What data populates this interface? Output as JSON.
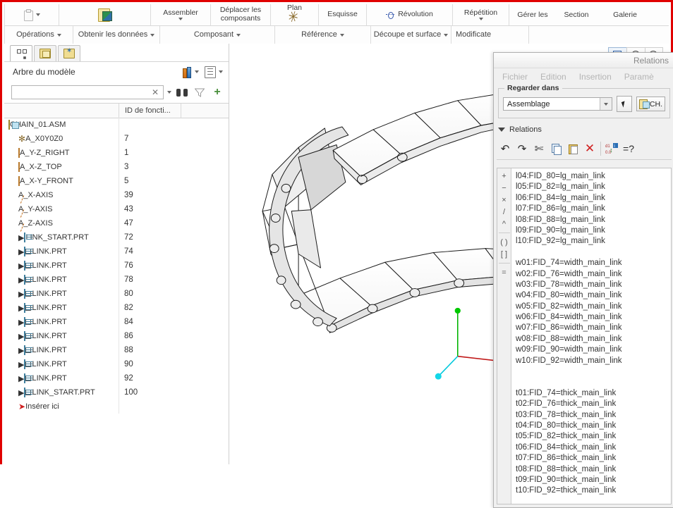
{
  "ribbon": {
    "row1": [
      {
        "label": "",
        "icon": "clipboard-icon",
        "has_caret": true
      },
      {
        "label": "",
        "icon": "get-data-icon",
        "has_caret": false
      },
      {
        "label": "Assembler",
        "icon": "",
        "has_caret": true
      },
      {
        "label": "Déplacer les composants",
        "icon": "",
        "has_caret": false
      },
      {
        "label": "Plan",
        "icon": "plane-icon",
        "has_caret": false
      },
      {
        "label": "Esquisse",
        "icon": "",
        "has_caret": false
      },
      {
        "label": "Révolution",
        "icon": "revolve-icon",
        "has_caret": false
      },
      {
        "label": "Répétition",
        "icon": "",
        "has_caret": true
      },
      {
        "label": "Gérer les",
        "icon": "",
        "has_caret": false
      },
      {
        "label": "Section",
        "icon": "",
        "has_caret": false
      },
      {
        "label": "Galerie",
        "icon": "",
        "has_caret": false
      }
    ],
    "row2": [
      {
        "label": "Opérations",
        "has_caret": true
      },
      {
        "label": "Obtenir les données",
        "has_caret": true
      },
      {
        "label": "Composant",
        "has_caret": true
      },
      {
        "label": "Référence",
        "has_caret": true
      },
      {
        "label": "Découpe et surface",
        "has_caret": true
      },
      {
        "label": "Modificate",
        "has_caret": false
      }
    ]
  },
  "navigator": {
    "tabs": [
      {
        "name": "model-tree-tab",
        "icon": "tree-icon"
      },
      {
        "name": "folder-browser-tab",
        "icon": "folders-icon"
      },
      {
        "name": "favorites-tab",
        "icon": "favorites-folder-icon"
      }
    ],
    "title": "Arbre du modèle",
    "search": {
      "value": "",
      "placeholder": ""
    },
    "columns": [
      "",
      "ID de foncti...",
      ""
    ],
    "tree": [
      {
        "indent": 0,
        "expander": false,
        "icon": "assembly-icon",
        "label": "CHAIN_01.ASM",
        "id": ""
      },
      {
        "indent": 1,
        "expander": false,
        "icon": "csys-icon",
        "label": "A_X0Y0Z0",
        "id": "7"
      },
      {
        "indent": 1,
        "expander": false,
        "icon": "plane-icon",
        "label": "A_Y-Z_RIGHT",
        "id": "1"
      },
      {
        "indent": 1,
        "expander": false,
        "icon": "plane-icon",
        "label": "A_X-Z_TOP",
        "id": "3"
      },
      {
        "indent": 1,
        "expander": false,
        "icon": "plane-icon",
        "label": "A_X-Y_FRONT",
        "id": "5"
      },
      {
        "indent": 1,
        "expander": false,
        "icon": "axis-icon",
        "label": "A_X-AXIS",
        "id": "39"
      },
      {
        "indent": 1,
        "expander": false,
        "icon": "axis-icon",
        "label": "A_Y-AXIS",
        "id": "43"
      },
      {
        "indent": 1,
        "expander": false,
        "icon": "axis-icon",
        "label": "A_Z-AXIS",
        "id": "47"
      },
      {
        "indent": 1,
        "expander": true,
        "icon": "part-icon",
        "label": "LINK_START.PRT",
        "id": "72",
        "badge": false
      },
      {
        "indent": 1,
        "expander": true,
        "icon": "part-icon",
        "label": "LINK.PRT",
        "id": "74",
        "badge": true
      },
      {
        "indent": 1,
        "expander": true,
        "icon": "part-icon",
        "label": "LINK.PRT",
        "id": "76",
        "badge": true
      },
      {
        "indent": 1,
        "expander": true,
        "icon": "part-icon",
        "label": "LINK.PRT",
        "id": "78",
        "badge": true
      },
      {
        "indent": 1,
        "expander": true,
        "icon": "part-icon",
        "label": "LINK.PRT",
        "id": "80",
        "badge": true
      },
      {
        "indent": 1,
        "expander": true,
        "icon": "part-icon",
        "label": "LINK.PRT",
        "id": "82",
        "badge": true
      },
      {
        "indent": 1,
        "expander": true,
        "icon": "part-icon",
        "label": "LINK.PRT",
        "id": "84",
        "badge": true
      },
      {
        "indent": 1,
        "expander": true,
        "icon": "part-icon",
        "label": "LINK.PRT",
        "id": "86",
        "badge": true
      },
      {
        "indent": 1,
        "expander": true,
        "icon": "part-icon",
        "label": "LINK.PRT",
        "id": "88",
        "badge": true
      },
      {
        "indent": 1,
        "expander": true,
        "icon": "part-icon",
        "label": "LINK.PRT",
        "id": "90",
        "badge": true
      },
      {
        "indent": 1,
        "expander": true,
        "icon": "part-icon",
        "label": "LINK.PRT",
        "id": "92",
        "badge": true
      },
      {
        "indent": 1,
        "expander": true,
        "icon": "part-icon",
        "label": "LINK_START.PRT",
        "id": "100",
        "badge": true
      },
      {
        "indent": 1,
        "expander": false,
        "icon": "insert-here-icon",
        "label": "Insérer ici",
        "id": ""
      }
    ]
  },
  "viewport": {
    "tools": [
      {
        "name": "zoom-window-tool",
        "icon": "magnifier-box-icon",
        "selected": true
      },
      {
        "name": "zoom-in-tool",
        "icon": "magnifier-plus-icon",
        "selected": false
      },
      {
        "name": "zoom-out-tool",
        "icon": "magnifier-minus-icon",
        "selected": false
      }
    ],
    "triad": {
      "x_axis_color": "#d02020",
      "y_axis_color": "#00c000",
      "z_axis_color": "#00d8e8"
    },
    "model_description": "U-shaped cable carrier drag chain assembly, isometric view"
  },
  "relations_dialog": {
    "title": "Relations",
    "menu": [
      "Fichier",
      "Edition",
      "Insertion",
      "Paramè"
    ],
    "lookin": {
      "legend": "Regarder dans",
      "value": "Assemblage",
      "select_button": "select-arrow-icon",
      "model_button": "CH."
    },
    "section_label": "Relations",
    "toolbar": [
      {
        "name": "undo-button",
        "icon": "undo-icon"
      },
      {
        "name": "redo-button",
        "icon": "redo-icon"
      },
      {
        "name": "cut-button",
        "icon": "scissors-icon"
      },
      {
        "name": "copy-button",
        "icon": "copy-icon"
      },
      {
        "name": "paste-button",
        "icon": "paste-icon"
      },
      {
        "name": "delete-button",
        "icon": "red-x-icon"
      },
      {
        "name": "dimension-switch-button",
        "icon": "dimension-toggle-icon"
      },
      {
        "name": "verify-relations-button",
        "icon": "equals-question-icon"
      }
    ],
    "operators": [
      "+",
      "−",
      "×",
      "/",
      "^",
      "( )",
      "[ ]",
      "="
    ],
    "relations": [
      "l04:FID_80=lg_main_link",
      "l05:FID_82=lg_main_link",
      "l06:FID_84=lg_main_link",
      "l07:FID_86=lg_main_link",
      "l08:FID_88=lg_main_link",
      "l09:FID_90=lg_main_link",
      "l10:FID_92=lg_main_link",
      "",
      "w01:FID_74=width_main_link",
      "w02:FID_76=width_main_link",
      "w03:FID_78=width_main_link",
      "w04:FID_80=width_main_link",
      "w05:FID_82=width_main_link",
      "w06:FID_84=width_main_link",
      "w07:FID_86=width_main_link",
      "w08:FID_88=width_main_link",
      "w09:FID_90=width_main_link",
      "w10:FID_92=width_main_link",
      "",
      "",
      "t01:FID_74=thick_main_link",
      "t02:FID_76=thick_main_link",
      "t03:FID_78=thick_main_link",
      "t04:FID_80=thick_main_link",
      "t05:FID_82=thick_main_link",
      "t06:FID_84=thick_main_link",
      "t07:FID_86=thick_main_link",
      "t08:FID_88=thick_main_link",
      "t09:FID_90=thick_main_link",
      "t10:FID_92=thick_main_link"
    ]
  },
  "colors": {
    "accent_red": "#e00000",
    "panel_bg": "#f0f0f0",
    "viewport_bg": "#ffffff"
  }
}
